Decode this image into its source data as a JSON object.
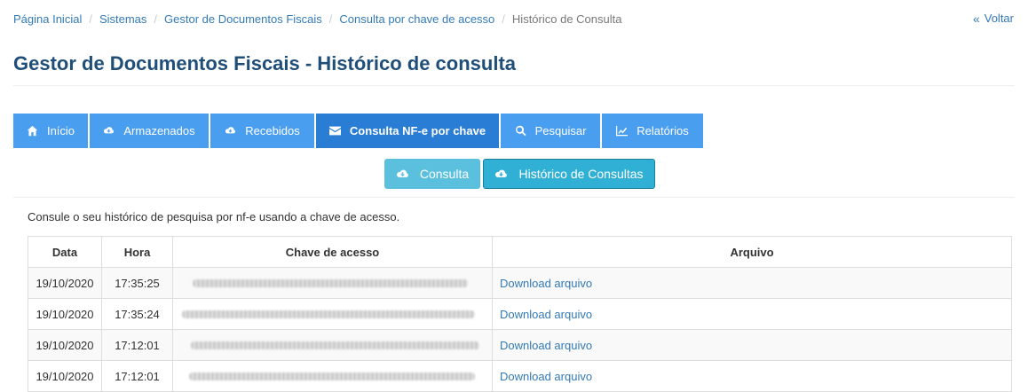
{
  "breadcrumb": {
    "items": [
      "Página Inicial",
      "Sistemas",
      "Gestor de Documentos Fiscais",
      "Consulta por chave de acesso"
    ],
    "current": "Histórico de Consulta",
    "separator": "/"
  },
  "back_label": "Voltar",
  "page_title": "Gestor de Documentos Fiscais - Histórico de consulta",
  "nav": [
    {
      "label": "Início",
      "icon": "home-icon"
    },
    {
      "label": "Armazenados",
      "icon": "cloud-download-icon"
    },
    {
      "label": "Recebidos",
      "icon": "cloud-download-icon"
    },
    {
      "label": "Consulta NF-e por chave",
      "icon": "envelope-icon",
      "active": true
    },
    {
      "label": "Pesquisar",
      "icon": "search-icon"
    },
    {
      "label": "Relatórios",
      "icon": "line-chart-icon"
    }
  ],
  "subtabs": [
    {
      "label": "Consulta",
      "icon": "cloud-download-icon"
    },
    {
      "label": "Histórico de Consultas",
      "icon": "cloud-download-icon",
      "active": true
    }
  ],
  "description": "Consule o seu histórico de pesquisa por nf-e usando a chave de acesso.",
  "table": {
    "headers": [
      "Data",
      "Hora",
      "Chave de acesso",
      "Arquivo"
    ],
    "rows": [
      {
        "data": "19/10/2020",
        "hora": "17:35:25",
        "chave": "",
        "arquivo": "Download arquivo"
      },
      {
        "data": "19/10/2020",
        "hora": "17:35:24",
        "chave": "",
        "arquivo": "Download arquivo"
      },
      {
        "data": "19/10/2020",
        "hora": "17:12:01",
        "chave": "",
        "arquivo": "Download arquivo"
      },
      {
        "data": "19/10/2020",
        "hora": "17:12:01",
        "chave": "",
        "arquivo": "Download arquivo"
      }
    ]
  },
  "colors": {
    "primary": "#4a9ef0",
    "primary_active": "#2a7dd4",
    "info": "#5bc0de",
    "info_active": "#31b0d5",
    "link": "#337ab7",
    "title": "#1f4e79"
  }
}
